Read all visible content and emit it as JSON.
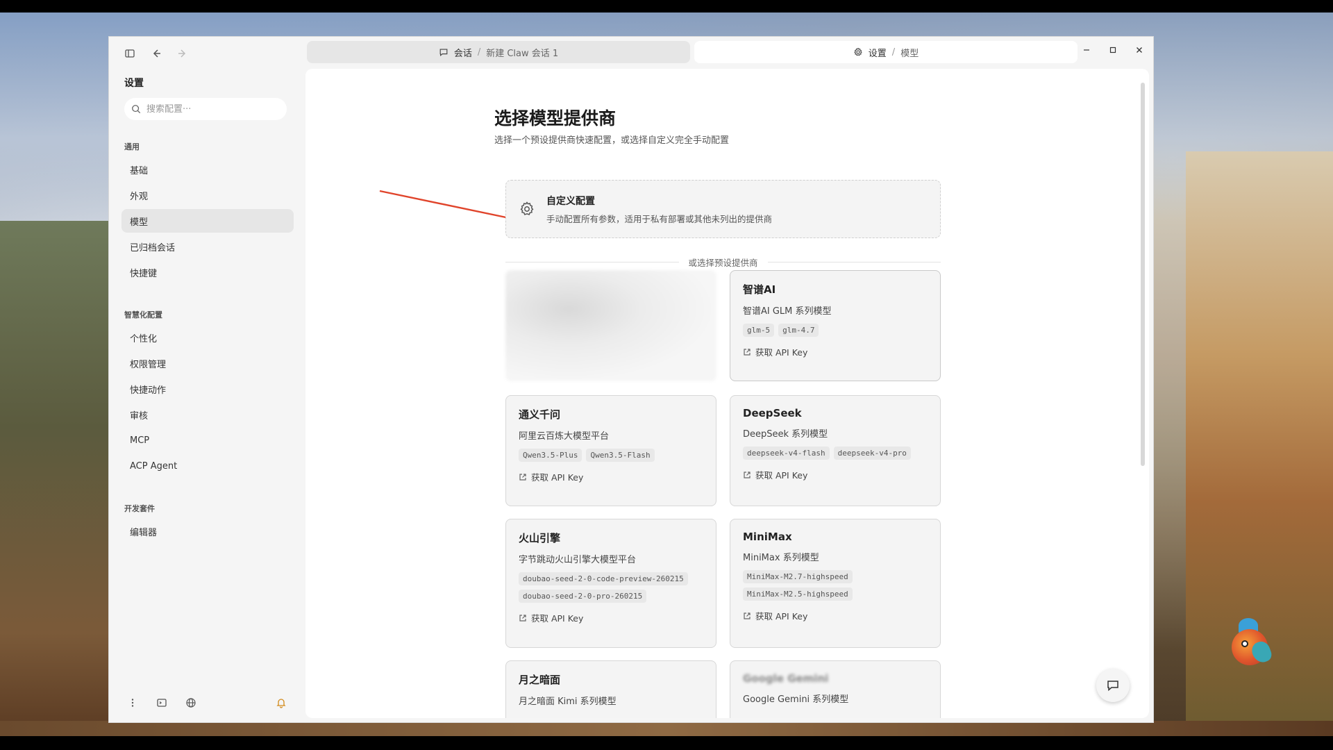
{
  "window": {
    "sidebar_title": "设置",
    "search_placeholder": "搜索配置···",
    "sections": [
      {
        "label": "通用",
        "items": [
          "基础",
          "外观",
          "模型",
          "已归档会话",
          "快捷键"
        ]
      },
      {
        "label": "智慧化配置",
        "items": [
          "个性化",
          "权限管理",
          "快捷动作",
          "审核",
          "MCP",
          "ACP Agent"
        ]
      },
      {
        "label": "开发套件",
        "items": [
          "编辑器"
        ]
      }
    ],
    "active_item": "模型"
  },
  "tabs": [
    {
      "icon": "chat-icon",
      "crumb_main": "会话",
      "sep": "/",
      "crumb_sub": "新建 Claw 会话 1"
    },
    {
      "icon": "gear-icon",
      "crumb_main": "设置",
      "sep": "/",
      "crumb_sub": "模型"
    }
  ],
  "page": {
    "heading": "选择模型提供商",
    "subheading": "选择一个预设提供商快速配置，或选择自定义完全手动配置",
    "custom": {
      "title": "自定义配置",
      "desc": "手动配置所有参数，适用于私有部署或其他未列出的提供商"
    },
    "divider_text": "或选择预设提供商",
    "providers": [
      {
        "name": "智谱AI",
        "desc": "智谱AI GLM 系列模型",
        "tags": [
          "glm-5",
          "glm-4.7"
        ],
        "apikey": "获取 API Key"
      },
      {
        "name": "通义千问",
        "desc": "阿里云百炼大模型平台",
        "tags": [
          "Qwen3.5-Plus",
          "Qwen3.5-Flash"
        ],
        "apikey": "获取 API Key"
      },
      {
        "name": "DeepSeek",
        "desc": "DeepSeek 系列模型",
        "tags": [
          "deepseek-v4-flash",
          "deepseek-v4-pro"
        ],
        "apikey": "获取 API Key"
      },
      {
        "name": "火山引擎",
        "desc": "字节跳动火山引擎大模型平台",
        "tags": [
          "doubao-seed-2-0-code-preview-260215",
          "doubao-seed-2-0-pro-260215"
        ],
        "apikey": "获取 API Key"
      },
      {
        "name": "MiniMax",
        "desc": "MiniMax 系列模型",
        "tags": [
          "MiniMax-M2.7-highspeed",
          "MiniMax-M2.5-highspeed"
        ],
        "apikey": "获取 API Key"
      },
      {
        "name": "月之暗面",
        "desc": "月之暗面 Kimi 系列模型",
        "tags": [],
        "apikey": ""
      },
      {
        "name": "Google Gemini",
        "desc": "Google Gemini 系列模型",
        "tags": [],
        "apikey": ""
      }
    ]
  }
}
